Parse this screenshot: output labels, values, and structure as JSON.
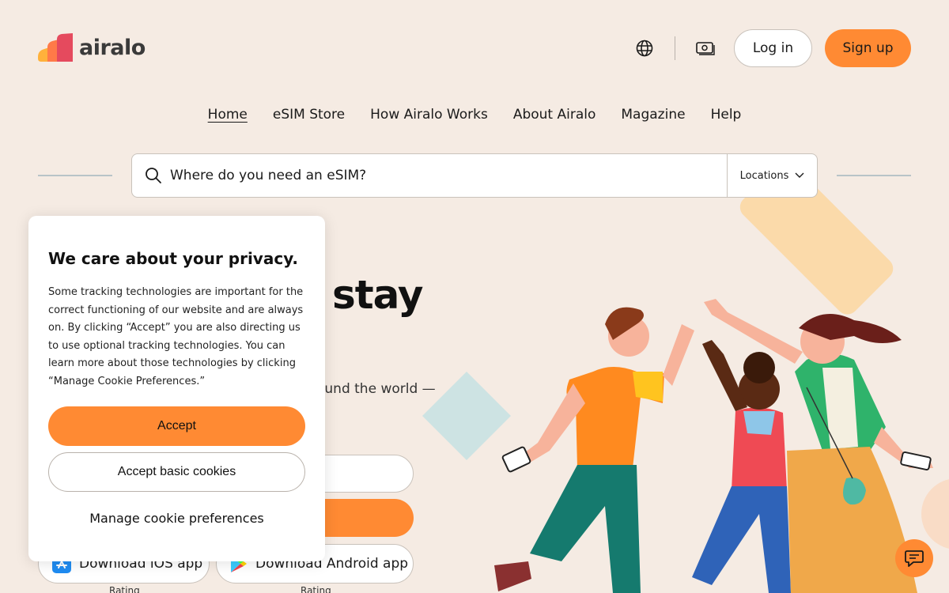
{
  "brand": {
    "name": "airalo"
  },
  "header": {
    "language_icon": "globe-icon",
    "currency_icon": "money-icon",
    "login_label": "Log in",
    "signup_label": "Sign up"
  },
  "nav": {
    "items": [
      {
        "label": "Home",
        "active": true
      },
      {
        "label": "eSIM Store"
      },
      {
        "label": "How Airalo Works"
      },
      {
        "label": "About Airalo"
      },
      {
        "label": "Magazine"
      },
      {
        "label": "Help"
      }
    ]
  },
  "search": {
    "placeholder": "Where do you need an eSIM?",
    "scope_label": "Locations"
  },
  "hero": {
    "title_fragment": "stay",
    "subtitle_fragment": "ound the world —",
    "download_ios": "Download iOS app",
    "download_android": "Download Android app",
    "rating_label": "Rating"
  },
  "cookie": {
    "title": "We care about your privacy.",
    "body": "Some tracking technologies are important for the correct functioning of our website and are always on. By clicking “Accept” you are also directing us to use optional tracking technologies. You can learn more about those technologies by clicking “Manage Cookie Preferences.”",
    "accept_label": "Accept",
    "basic_label": "Accept basic cookies",
    "manage_label": "Manage cookie preferences"
  },
  "colors": {
    "background": "#f5ebe3",
    "accent": "#ff8a33"
  }
}
